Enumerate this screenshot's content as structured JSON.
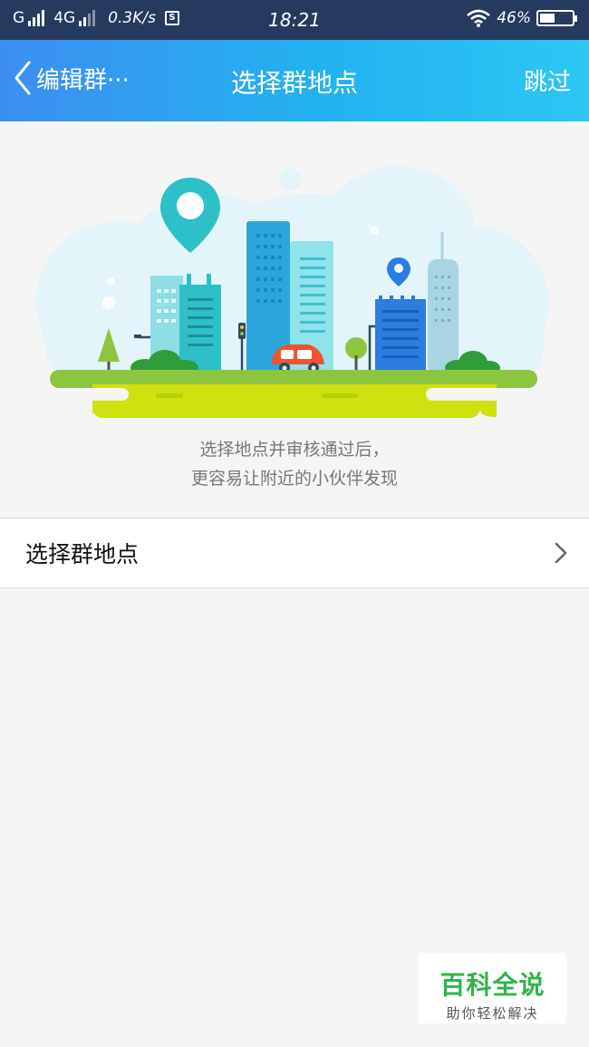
{
  "status_bar": {
    "carrier_left": "G",
    "network": "4G",
    "speed": "0.3K/s",
    "s_icon": "S",
    "time": "18:21",
    "battery": "46%",
    "battery_level": 0.46
  },
  "nav": {
    "back_label": "编辑群···",
    "title": "选择群地点",
    "skip_label": "跳过"
  },
  "hero": {
    "caption_line1": "选择地点并审核通过后，",
    "caption_line2": "更容易让附近的小伙伴发现"
  },
  "list": {
    "item_label": "选择群地点"
  },
  "watermark": {
    "title": "百科全说",
    "subtitle": "助你轻松解决"
  },
  "colors": {
    "status_bg": "#253a5e",
    "nav_gradient_start": "#3d8ef0",
    "nav_gradient_end": "#2ec6f3",
    "watermark_green": "#2fb44a"
  }
}
